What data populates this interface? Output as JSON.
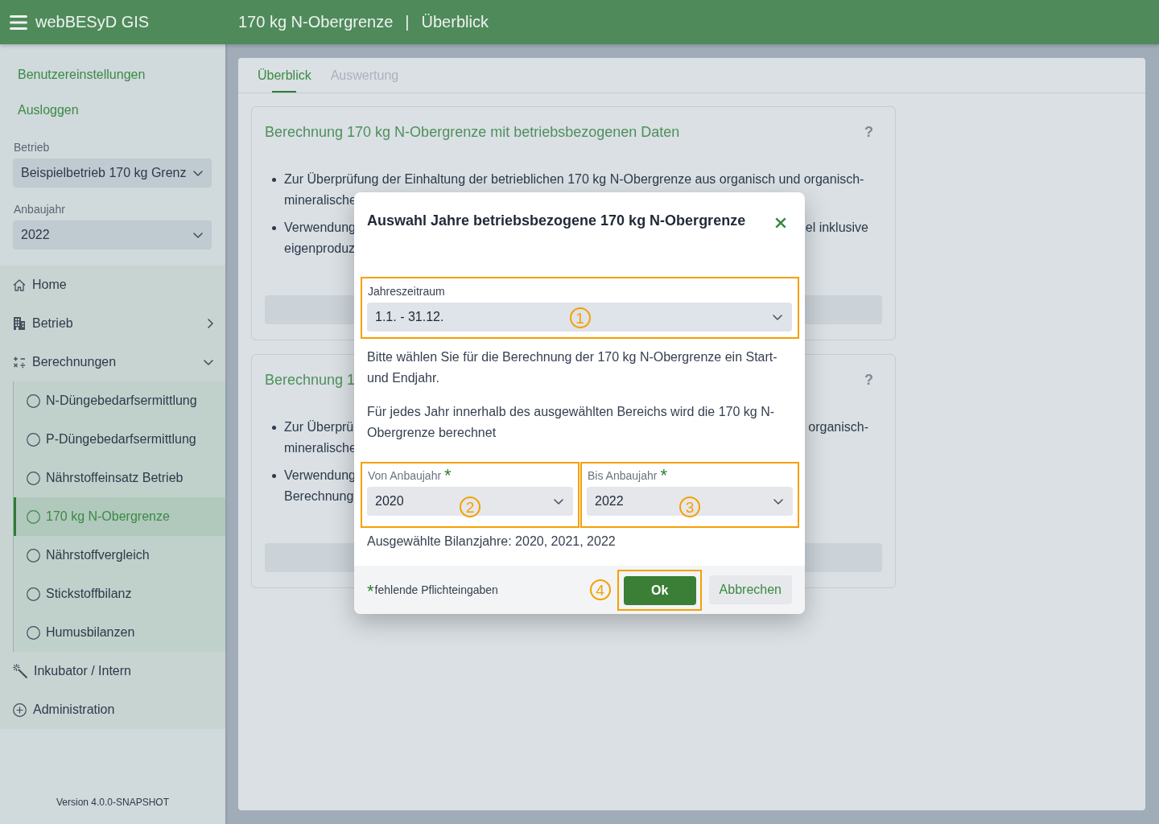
{
  "header": {
    "app_title": "webBESyD GIS",
    "page_title": "170 kg N-Obergrenze",
    "separator": "|",
    "section": "Überblick"
  },
  "sidebar": {
    "links": [
      {
        "label": "Benutzereinstellungen"
      },
      {
        "label": "Ausloggen"
      }
    ],
    "filters": [
      {
        "label": "Betrieb",
        "value": "Beispielbetrieb 170 kg Grenz"
      },
      {
        "label": "Anbaujahr",
        "value": "2022"
      }
    ],
    "nav": [
      {
        "label": "Home"
      },
      {
        "label": "Betrieb",
        "expanded": false
      },
      {
        "label": "Berechnungen",
        "expanded": true,
        "children": [
          {
            "label": "N-Düngebedarfsermittlung",
            "selected": false
          },
          {
            "label": "P-Düngebedarfsermittlung",
            "selected": false
          },
          {
            "label": "Nährstoffeinsatz Betrieb",
            "selected": false
          },
          {
            "label": "170 kg N-Obergrenze",
            "selected": true
          },
          {
            "label": "Nährstoffvergleich",
            "selected": false
          },
          {
            "label": "Stickstoffbilanz",
            "selected": false
          },
          {
            "label": "Humusbilanzen",
            "selected": false
          }
        ]
      },
      {
        "label": "Inkubator / Intern"
      },
      {
        "label": "Administration"
      }
    ],
    "version": "Version 4.0.0-SNAPSHOT"
  },
  "tabs": [
    {
      "label": "Überblick",
      "selected": true
    },
    {
      "label": "Auswertung",
      "selected": false
    }
  ],
  "cards": [
    {
      "title": "Berechnung 170 kg N-Obergrenze mit betriebsbezogenen Daten",
      "help": "?",
      "bullets": [
        {
          "lines": [
            {
              "left": "Zur Überprüfung der Einhaltung der betrieblichen 170 kg N-Obergrenze aus organisch und organisch-"
            },
            {
              "left": "mineralische"
            }
          ]
        },
        {
          "lines": [
            {
              "left": "Verwendung",
              "right": "el inklusive"
            },
            {
              "left": "eigenproduz"
            }
          ]
        }
      ]
    },
    {
      "title": "Berechnung 1",
      "help": "?",
      "bullets": [
        {
          "lines": [
            {
              "left": "Zur Überprü",
              "right": "organisch-"
            },
            {
              "left": "mineralische"
            }
          ]
        },
        {
          "lines": [
            {
              "left": "Verwendung"
            },
            {
              "left": "Berechnung"
            }
          ]
        }
      ]
    }
  ],
  "dialog": {
    "title": "Auswahl Jahre betriebsbezogene 170 kg N-Obergrenze",
    "period": {
      "label": "Jahreszeitraum",
      "value": "1.1. - 31.12.",
      "highlighted": true,
      "callout": "1"
    },
    "paragraphs": [
      "Bitte wählen Sie für die Berechnung der 170 kg N-Obergrenze ein Start- und Endjahr.",
      "Für jedes Jahr innerhalb des ausgewählten Bereichs wird die 170 kg N-Obergrenze berechnet"
    ],
    "year_fields": [
      {
        "label": "Von Anbaujahr",
        "required_mark": "*",
        "value": "2020",
        "highlighted": true,
        "callout": "2"
      },
      {
        "label": "Bis Anbaujahr",
        "required_mark": "*",
        "value": "2022",
        "highlighted": true,
        "callout": "3"
      }
    ],
    "summary": "Ausgewählte Bilanzjahre: 2020, 2021, 2022",
    "legend": {
      "mark": "*",
      "text": "fehlende Pflichteingaben"
    },
    "buttons": [
      {
        "label": "Ok",
        "kind": "primary",
        "highlighted": true,
        "callout": "4"
      },
      {
        "label": "Abbrechen",
        "kind": "secondary",
        "highlighted": false
      }
    ]
  }
}
